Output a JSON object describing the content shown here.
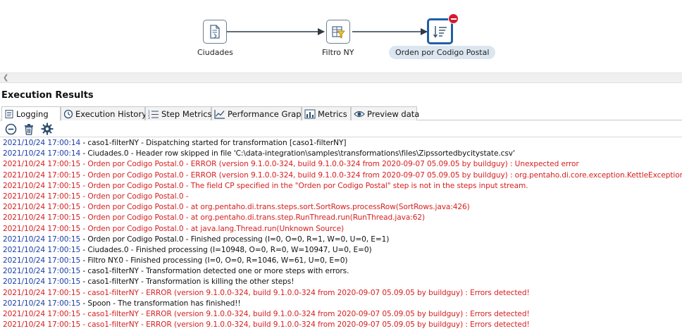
{
  "canvas": {
    "steps": [
      {
        "id": "ciudades",
        "label": "Ciudades",
        "icon": "text-file-input-icon"
      },
      {
        "id": "filtro",
        "label": "Filtro NY",
        "icon": "filter-rows-icon"
      },
      {
        "id": "orden",
        "label": "Orden por Codigo Postal",
        "icon": "sort-rows-icon",
        "selected": true,
        "error": true
      }
    ]
  },
  "execution": {
    "title": "Execution Results",
    "tabs": [
      {
        "label": "Logging",
        "icon": "logging-icon",
        "active": true
      },
      {
        "label": "Execution History",
        "icon": "clock-icon"
      },
      {
        "label": "Step Metrics",
        "icon": "list-icon"
      },
      {
        "label": "Performance Graph",
        "icon": "graph-icon"
      },
      {
        "label": "Metrics",
        "icon": "bar-chart-icon"
      },
      {
        "label": "Preview data",
        "icon": "eye-icon"
      }
    ],
    "toolbar": [
      "stop-icon",
      "trash-icon",
      "gear-icon"
    ]
  },
  "colors": {
    "info": "#111111",
    "timestamp": "#1a3fa8",
    "error": "#d61f1f",
    "accent": "#1f5fa8"
  },
  "log": [
    {
      "ts": "2021/10/24 17:00:14",
      "msg": " - caso1-filterNY - Dispatching started for transformation [caso1-filterNY]",
      "level": "info"
    },
    {
      "ts": "2021/10/24 17:00:14",
      "msg": " - Ciudades.0 - Header row skipped in file 'C:\\data-integration\\samples\\transformations\\files\\Zipssortedbycitystate.csv'",
      "level": "info"
    },
    {
      "ts": "2021/10/24 17:00:15",
      "msg": " - Orden por Codigo Postal.0 - ERROR (version 9.1.0.0-324, build 9.1.0.0-324 from 2020-09-07 05.09.05 by buildguy) : Unexpected error",
      "level": "err"
    },
    {
      "ts": "2021/10/24 17:00:15",
      "msg": " - Orden por Codigo Postal.0 - ERROR (version 9.1.0.0-324, build 9.1.0.0-324 from 2020-09-07 05.09.05 by buildguy) : org.pentaho.di.core.exception.KettleException:",
      "level": "err"
    },
    {
      "ts": "2021/10/24 17:00:15",
      "msg": " - Orden por Codigo Postal.0 - The field CP specified in the \"Orden por Codigo Postal\" step is not in the steps input stream.",
      "level": "err"
    },
    {
      "ts": "2021/10/24 17:00:15",
      "msg": " - Orden por Codigo Postal.0 -",
      "level": "err"
    },
    {
      "ts": "2021/10/24 17:00:15",
      "msg": " - Orden por Codigo Postal.0 -     at org.pentaho.di.trans.steps.sort.SortRows.processRow(SortRows.java:426)",
      "level": "err"
    },
    {
      "ts": "2021/10/24 17:00:15",
      "msg": " - Orden por Codigo Postal.0 -     at org.pentaho.di.trans.step.RunThread.run(RunThread.java:62)",
      "level": "err"
    },
    {
      "ts": "2021/10/24 17:00:15",
      "msg": " - Orden por Codigo Postal.0 -     at java.lang.Thread.run(Unknown Source)",
      "level": "err"
    },
    {
      "ts": "2021/10/24 17:00:15",
      "msg": " - Orden por Codigo Postal.0 - Finished processing (I=0, O=0, R=1, W=0, U=0, E=1)",
      "level": "info"
    },
    {
      "ts": "2021/10/24 17:00:15",
      "msg": " - Ciudades.0 - Finished processing (I=10948, O=0, R=0, W=10947, U=0, E=0)",
      "level": "info"
    },
    {
      "ts": "2021/10/24 17:00:15",
      "msg": " - Filtro NY.0 - Finished processing (I=0, O=0, R=1046, W=61, U=0, E=0)",
      "level": "info"
    },
    {
      "ts": "2021/10/24 17:00:15",
      "msg": " - caso1-filterNY - Transformation detected one or more steps with errors.",
      "level": "info"
    },
    {
      "ts": "2021/10/24 17:00:15",
      "msg": " - caso1-filterNY - Transformation is killing the other steps!",
      "level": "info"
    },
    {
      "ts": "2021/10/24 17:00:15",
      "msg": " - caso1-filterNY - ERROR (version 9.1.0.0-324, build 9.1.0.0-324 from 2020-09-07 05.09.05 by buildguy) : Errors detected!",
      "level": "err"
    },
    {
      "ts": "2021/10/24 17:00:15",
      "msg": " - Spoon - The transformation has finished!!",
      "level": "info"
    },
    {
      "ts": "2021/10/24 17:00:15",
      "msg": " - caso1-filterNY - ERROR (version 9.1.0.0-324, build 9.1.0.0-324 from 2020-09-07 05.09.05 by buildguy) : Errors detected!",
      "level": "err"
    },
    {
      "ts": "2021/10/24 17:00:15",
      "msg": " - caso1-filterNY - ERROR (version 9.1.0.0-324, build 9.1.0.0-324 from 2020-09-07 05.09.05 by buildguy) : Errors detected!",
      "level": "err"
    }
  ]
}
